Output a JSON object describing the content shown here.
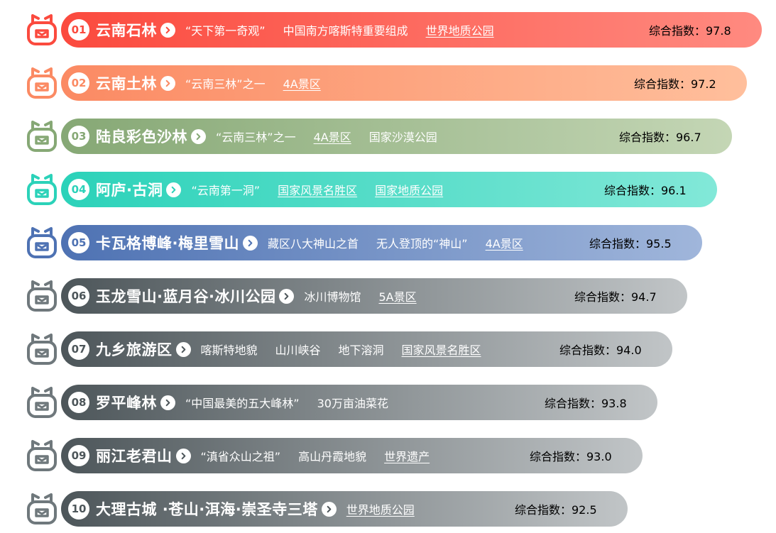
{
  "rankings": [
    {
      "rank": "01",
      "name": "云南石林",
      "tags": [
        {
          "text": "“天下第一奇观”",
          "link": false
        },
        {
          "text": "中国南方喀斯特重要组成",
          "link": false
        },
        {
          "text": "世界地质公园",
          "link": true
        }
      ],
      "score": "综合指数：97.8"
    },
    {
      "rank": "02",
      "name": "云南土林",
      "tags": [
        {
          "text": "“云南三林”之一",
          "link": false
        },
        {
          "text": "4A景区",
          "link": true
        }
      ],
      "score": "综合指数：97.2"
    },
    {
      "rank": "03",
      "name": "陆良彩色沙林",
      "tags": [
        {
          "text": "“云南三林”之一",
          "link": false
        },
        {
          "text": "4A景区",
          "link": true
        },
        {
          "text": "国家沙漠公园",
          "link": false
        }
      ],
      "score": "综合指数：96.7"
    },
    {
      "rank": "04",
      "name": "阿庐·古洞",
      "tags": [
        {
          "text": "“云南第一洞”",
          "link": false
        },
        {
          "text": "国家风景名胜区",
          "link": true
        },
        {
          "text": "国家地质公园",
          "link": true
        }
      ],
      "score": "综合指数：96.1"
    },
    {
      "rank": "05",
      "name": "卡瓦格博峰·梅里雪山",
      "tags": [
        {
          "text": "藏区八大神山之首",
          "link": false
        },
        {
          "text": "无人登顶的“神山”",
          "link": false
        },
        {
          "text": "4A景区",
          "link": true
        }
      ],
      "score": "综合指数：95.5"
    },
    {
      "rank": "06",
      "name": "玉龙雪山·蓝月谷·冰川公园",
      "tags": [
        {
          "text": "冰川博物馆",
          "link": false
        },
        {
          "text": "5A景区",
          "link": true
        }
      ],
      "score": "综合指数：94.7"
    },
    {
      "rank": "07",
      "name": "九乡旅游区",
      "tags": [
        {
          "text": "喀斯特地貌",
          "link": false
        },
        {
          "text": "山川峡谷",
          "link": false
        },
        {
          "text": "地下溶洞",
          "link": false
        },
        {
          "text": "国家风景名胜区",
          "link": true
        }
      ],
      "score": "综合指数：94.0"
    },
    {
      "rank": "08",
      "name": "罗平峰林",
      "tags": [
        {
          "text": "“中国最美的五大峰林”",
          "link": false
        },
        {
          "text": "30万亩油菜花",
          "link": false
        }
      ],
      "score": "综合指数：93.8"
    },
    {
      "rank": "09",
      "name": "丽江老君山",
      "tags": [
        {
          "text": "“滇省众山之祖”",
          "link": false
        },
        {
          "text": "高山丹霞地貌",
          "link": false
        },
        {
          "text": "世界遗产",
          "link": true
        }
      ],
      "score": "综合指数：93.0"
    },
    {
      "rank": "10",
      "name": "大理古城 ·苍山·洱海·崇圣寺三塔",
      "tags": [
        {
          "text": "世界地质公园",
          "link": true
        }
      ],
      "score": "综合指数：92.5"
    }
  ],
  "colors": {
    "rank_1": {
      "start": "#fb4a3e",
      "end": "#ff8a80"
    },
    "rank_2": {
      "start": "#fb8a63",
      "end": "#ffbf9c"
    },
    "rank_3": {
      "start": "#86a875",
      "end": "#c4d6b5"
    },
    "rank_4": {
      "start": "#2bd2b9",
      "end": "#82e8d8"
    },
    "rank_5": {
      "start": "#4e72b3",
      "end": "#a0b6db"
    },
    "rank_other": {
      "start": "#4d565a",
      "end": "#c1c5c7"
    }
  }
}
